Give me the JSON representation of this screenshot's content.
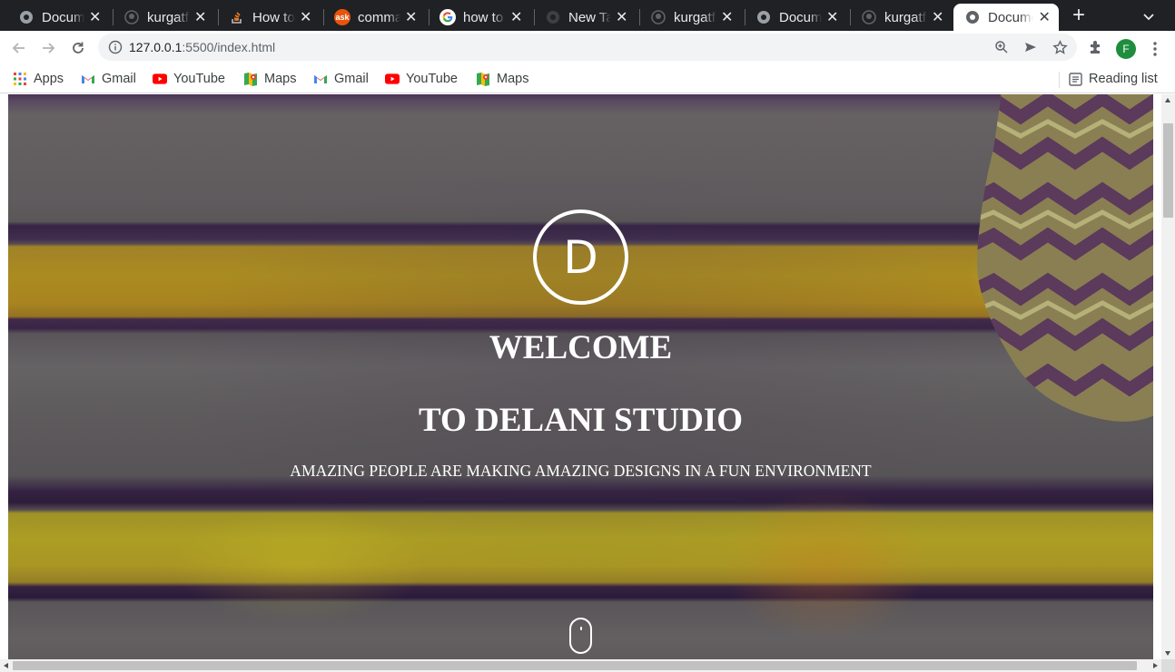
{
  "browser": {
    "tabs": [
      {
        "title": "Document",
        "icon": "globe-icon",
        "active": false
      },
      {
        "title": "kurgatf",
        "icon": "github-icon",
        "active": false
      },
      {
        "title": "How to",
        "icon": "stackoverflow-icon",
        "active": false
      },
      {
        "title": "command",
        "icon": "ask-icon",
        "active": false
      },
      {
        "title": "how to",
        "icon": "google-icon",
        "active": false
      },
      {
        "title": "New Tab",
        "icon": "globe-icon",
        "active": false
      },
      {
        "title": "kurgatf",
        "icon": "github-icon",
        "active": false
      },
      {
        "title": "Document",
        "icon": "globe-icon",
        "active": false
      },
      {
        "title": "kurgatf",
        "icon": "github-icon",
        "active": false
      },
      {
        "title": "Document",
        "icon": "globe-icon",
        "active": true
      }
    ],
    "ask_icon_text": "ask",
    "url_host": "127.0.0.1",
    "url_path": ":5500/index.html",
    "profile_initial": "F",
    "profile_color": "#1e8e3e"
  },
  "bookmarks": {
    "apps": "Apps",
    "items": [
      {
        "label": "Gmail",
        "icon": "gmail-icon"
      },
      {
        "label": "YouTube",
        "icon": "youtube-icon"
      },
      {
        "label": "Maps",
        "icon": "maps-icon"
      },
      {
        "label": "Gmail",
        "icon": "gmail-icon"
      },
      {
        "label": "YouTube",
        "icon": "youtube-icon"
      },
      {
        "label": "Maps",
        "icon": "maps-icon"
      }
    ],
    "reading_list": "Reading list"
  },
  "page": {
    "logo_letter": "D",
    "welcome": "WELCOME",
    "subtitle": "TO DELANI STUDIO",
    "tagline": "AMAZING PEOPLE ARE MAKING AMAZING DESIGNS IN A FUN ENVIRONMENT",
    "accent_yellow": "#d6b018",
    "stripe_dark": "#3b2547"
  }
}
